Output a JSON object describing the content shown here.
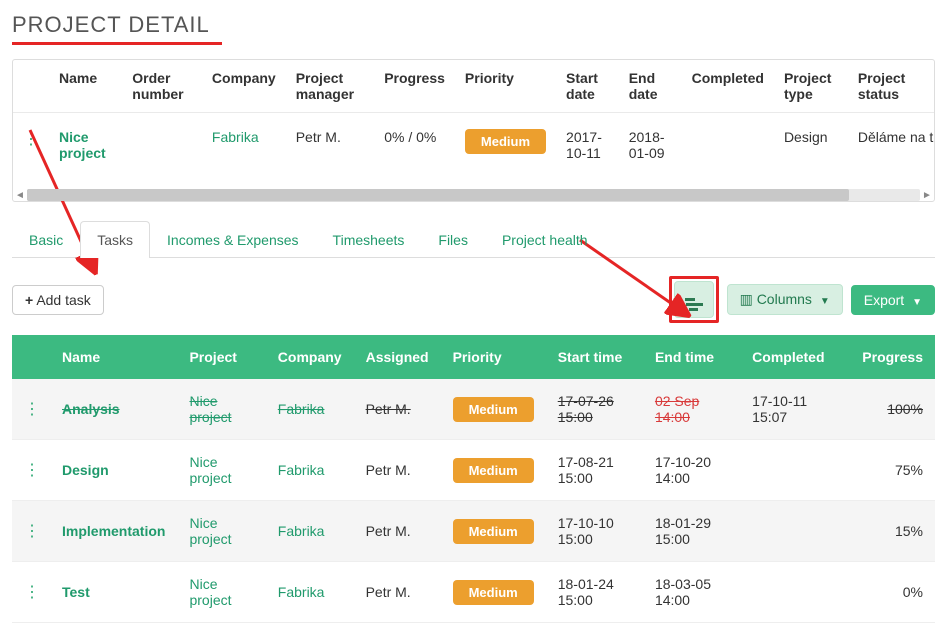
{
  "title": "PROJECT DETAIL",
  "summary": {
    "headers": [
      "Name",
      "Order number",
      "Company",
      "Project manager",
      "Progress",
      "Priority",
      "Start date",
      "End date",
      "Completed",
      "Project type",
      "Project status"
    ],
    "row": {
      "name": "Nice project",
      "order_number": "",
      "company": "Fabrika",
      "project_manager": "Petr M.",
      "progress": "0% / 0%",
      "priority": "Medium",
      "start_date": "2017-10-11",
      "end_date": "2018-01-09",
      "completed": "",
      "project_type": "Design",
      "project_status": "Děláme na to"
    }
  },
  "tabs": [
    "Basic",
    "Tasks",
    "Incomes & Expenses",
    "Timesheets",
    "Files",
    "Project health"
  ],
  "active_tab": "Tasks",
  "toolbar": {
    "add_task": "Add task",
    "columns": "Columns",
    "export": "Export"
  },
  "tasks": {
    "headers": [
      "Name",
      "Project",
      "Company",
      "Assigned",
      "Priority",
      "Start time",
      "End time",
      "Completed",
      "Progress"
    ],
    "rows": [
      {
        "name": "Analysis",
        "project": "Nice project",
        "company": "Fabrika",
        "assigned": "Petr M.",
        "priority": "Medium",
        "start": "17-07-26 15:00",
        "end": "02 Sep 14:00",
        "completed": "17-10-11 15:07",
        "progress": "100%",
        "done": true,
        "end_overdue": true
      },
      {
        "name": "Design",
        "project": "Nice project",
        "company": "Fabrika",
        "assigned": "Petr M.",
        "priority": "Medium",
        "start": "17-08-21 15:00",
        "end": "17-10-20 14:00",
        "completed": "",
        "progress": "75%",
        "done": false,
        "end_overdue": false
      },
      {
        "name": "Implementation",
        "project": "Nice project",
        "company": "Fabrika",
        "assigned": "Petr M.",
        "priority": "Medium",
        "start": "17-10-10 15:00",
        "end": "18-01-29 15:00",
        "completed": "",
        "progress": "15%",
        "done": false,
        "end_overdue": false
      },
      {
        "name": "Test",
        "project": "Nice project",
        "company": "Fabrika",
        "assigned": "Petr M.",
        "priority": "Medium",
        "start": "18-01-24 15:00",
        "end": "18-03-05 14:00",
        "completed": "",
        "progress": "0%",
        "done": false,
        "end_overdue": false
      }
    ]
  }
}
